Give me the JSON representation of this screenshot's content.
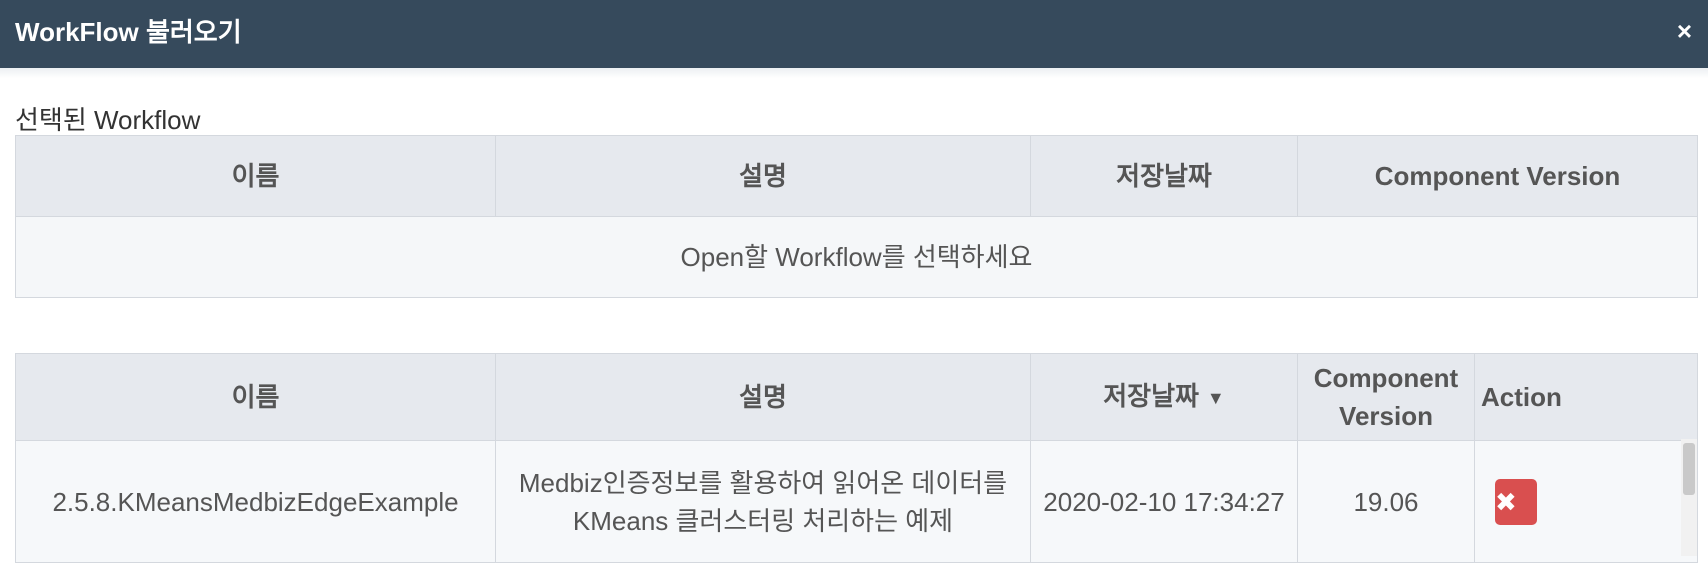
{
  "dialog": {
    "title": "WorkFlow 불러오기",
    "close_glyph": "×"
  },
  "selected_section": {
    "label": "선택된 Workflow",
    "columns": [
      "이름",
      "설명",
      "저장날짜",
      "Component Version"
    ],
    "empty_message": "Open할 Workflow를 선택하세요"
  },
  "workflow_list": {
    "columns": [
      "이름",
      "설명",
      "저장날짜",
      "Component Version",
      "Action"
    ],
    "sort_indicator": "▼",
    "rows": [
      {
        "name": "2.5.8.KMeansMedbizEdgeExample",
        "description": "Medbiz인증정보를 활용하여 읽어온 데이터를 KMeans 클러스터링 처리하는 예제",
        "saved_at": "2020-02-10 17:34:27",
        "component_version": "19.06",
        "delete_glyph": "✖"
      }
    ]
  },
  "colors": {
    "titlebar": "#364a5c",
    "header_bg": "#e6e9ee",
    "delete_button": "#d94f4f"
  }
}
